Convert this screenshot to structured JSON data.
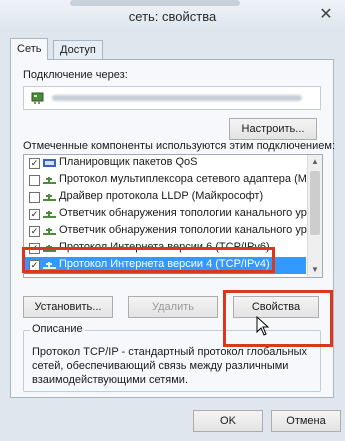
{
  "window": {
    "title": "сеть: свойства",
    "close_glyph": "✕"
  },
  "tabs": [
    {
      "label": "Сеть"
    },
    {
      "label": "Доступ"
    }
  ],
  "connection": {
    "label": "Подключение через:"
  },
  "buttons": {
    "configure": "Настроить...",
    "install": "Установить...",
    "uninstall": "Удалить",
    "properties": "Свойства",
    "ok": "OK",
    "cancel": "Отмена"
  },
  "components": {
    "label": "Отмеченные компоненты используются этим подключением:",
    "items": [
      {
        "checked": true,
        "icon": "qos-scheduler-icon",
        "label": "Планировщик пакетов QoS"
      },
      {
        "checked": false,
        "icon": "protocol-icon",
        "label": "Протокол мультиплексора сетевого адаптера (Май"
      },
      {
        "checked": false,
        "icon": "protocol-icon",
        "label": "Драйвер протокола LLDP (Майкрософт)"
      },
      {
        "checked": true,
        "icon": "protocol-icon",
        "label": "Ответчик обнаружения топологии канального уров"
      },
      {
        "checked": true,
        "icon": "protocol-icon",
        "label": "Ответчик обнаружения топологии канального уров"
      },
      {
        "checked": true,
        "icon": "protocol-icon",
        "label": "Протокол Интернета версии 6 (TCP/IPv6)"
      },
      {
        "checked": true,
        "icon": "protocol-icon",
        "label": "Протокол Интернета версии 4 (TCP/IPv4)",
        "selected": true
      }
    ]
  },
  "description": {
    "legend": "Описание",
    "text": "Протокол TCP/IP - стандартный протокол глобальных сетей, обеспечивающий связь между различными взаимодействующими сетями."
  },
  "colors": {
    "highlight": "#d9381e",
    "selection": "#3399ff"
  }
}
